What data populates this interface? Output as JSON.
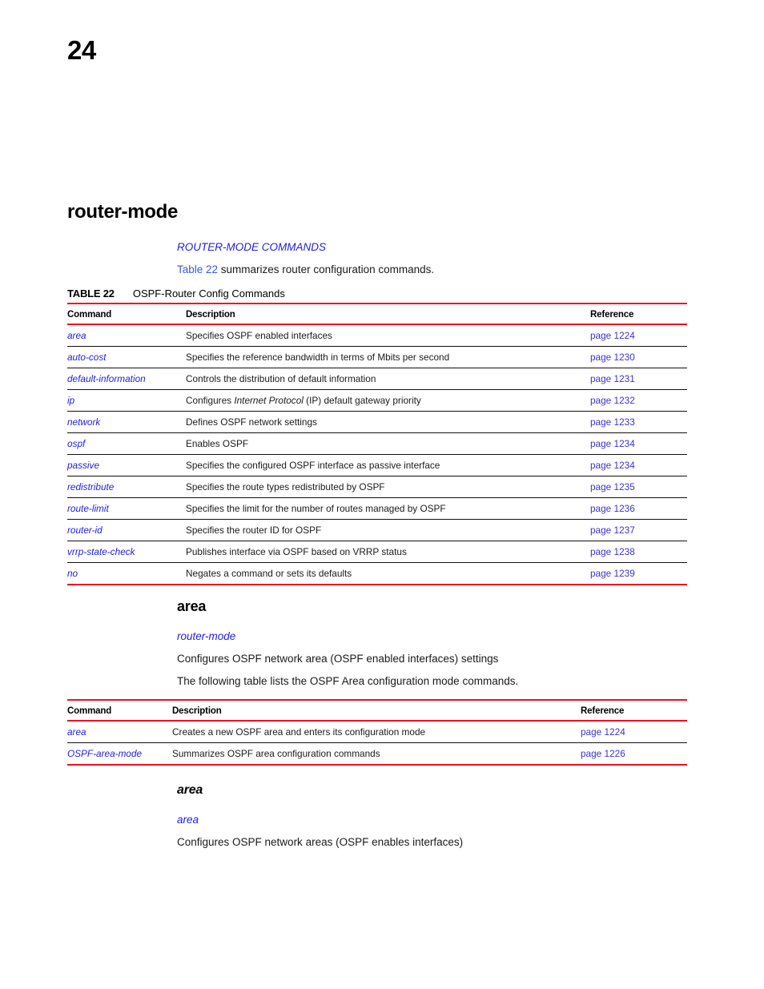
{
  "page": {
    "number": "24"
  },
  "chapter": {
    "title": "router-mode"
  },
  "intro": {
    "mode_label": "ROUTER-MODE COMMANDS",
    "summary_prefix": "Table 22",
    "summary_suffix": " summarizes router configuration commands."
  },
  "table22": {
    "caption_label": "TABLE 22",
    "caption_text": "OSPF-Router Config Commands",
    "headers": [
      "Command",
      "Description",
      "Reference"
    ],
    "rows": [
      {
        "command": "area",
        "description": "Specifies OSPF enabled interfaces",
        "reference": "page 1224"
      },
      {
        "command": "auto-cost",
        "description": "Specifies the reference bandwidth in terms of Mbits per second",
        "reference": "page 1230"
      },
      {
        "command": "default-information",
        "description": "Controls the distribution of default information",
        "reference": "page 1231"
      },
      {
        "command": "ip",
        "description_pre": "Configures ",
        "description_italic": "Internet Protocol",
        "description_post": " (IP) default gateway priority",
        "description": "Configures Internet Protocol (IP) default gateway priority",
        "reference": "page 1232"
      },
      {
        "command": "network",
        "description": "Defines OSPF network settings",
        "reference": "page 1233"
      },
      {
        "command": "ospf",
        "description": "Enables OSPF",
        "reference": "page 1234"
      },
      {
        "command": "passive",
        "description": "Specifies the configured OSPF interface as passive interface",
        "reference": "page 1234"
      },
      {
        "command": "redistribute",
        "description": "Specifies the route types redistributed by OSPF",
        "reference": "page 1235"
      },
      {
        "command": "route-limit",
        "description": "Specifies the limit for the number of routes managed by OSPF",
        "reference": "page 1236"
      },
      {
        "command": "router-id",
        "description": "Specifies the router ID for OSPF",
        "reference": "page 1237"
      },
      {
        "command": "vrrp-state-check",
        "description": "Publishes interface via OSPF based on VRRP status",
        "reference": "page 1238"
      },
      {
        "command": "no",
        "description": "Negates a command or sets its defaults",
        "reference": "page 1239"
      }
    ]
  },
  "section_area": {
    "heading": "area",
    "mode_label": "router-mode",
    "line1": "Configures OSPF network area (OSPF enabled interfaces) settings",
    "line2": "The following table lists the OSPF Area configuration mode commands."
  },
  "table_area": {
    "headers": [
      "Command",
      "Description",
      "Reference"
    ],
    "rows": [
      {
        "command": "area",
        "description": "Creates a new OSPF area and enters its configuration mode",
        "reference": "page 1224"
      },
      {
        "command": "OSPF-area-mode",
        "description": "Summarizes OSPF area configuration commands",
        "reference": "page 1226"
      }
    ]
  },
  "section_area_sub": {
    "heading": "area",
    "mode_label": "area",
    "line1": "Configures OSPF network areas (OSPF enables interfaces)"
  },
  "colors": {
    "rule_red": "#ee1122",
    "link_blue": "#3a33cc",
    "cmd_blue": "#2222dd",
    "xref_blue": "#3a58d8"
  }
}
